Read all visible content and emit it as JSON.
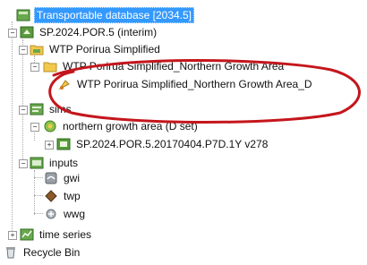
{
  "tree": {
    "root_label": "Transportable database [2034.5]",
    "scenario_label": "SP.2024.POR.5 (interim)",
    "wtp_group_label": "WTP Porirua Simplified",
    "wtp_child_label": "WTP Porirua Simplified_Northern Growth Area",
    "wtp_grandchild_label": "WTP Porirua Simplified_Northern Growth Area_D",
    "sims_label": "sims",
    "northern_label": "northern growth area (D set)",
    "sim_run_label": "SP.2024.POR.5.20170404.P7D.1Y v278",
    "inputs_label": "inputs",
    "gwi_label": "gwi",
    "twp_label": "twp",
    "wwg_label": "wwg",
    "time_series_label": "time series",
    "recycle_bin_label": "Recycle Bin"
  },
  "icons": {
    "database": "database-icon",
    "scenario": "scenario-icon",
    "network_folder": "network-folder-icon",
    "network": "network-icon",
    "sims_folder": "sims-folder-icon",
    "sim": "sim-icon",
    "inputs_folder": "inputs-folder-icon",
    "gwi": "gwi-icon",
    "twp": "twp-icon",
    "wwg": "wwg-icon",
    "time_series": "time-series-icon",
    "recycle_bin": "recycle-bin-icon"
  },
  "colors": {
    "selection": "#3399ff",
    "annotation": "#c4161c"
  }
}
